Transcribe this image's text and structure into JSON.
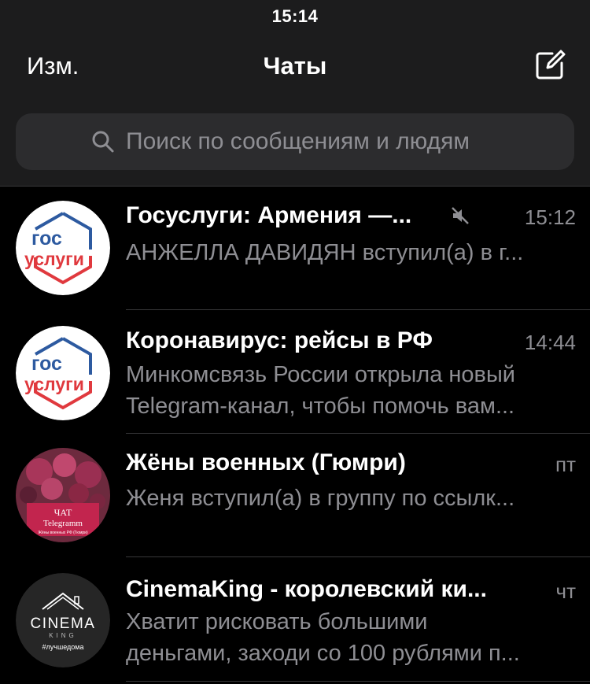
{
  "status_bar": {
    "time": "15:14"
  },
  "nav": {
    "edit_label": "Изм.",
    "title": "Чаты",
    "compose_icon": "compose-icon"
  },
  "search": {
    "placeholder": "Поиск по сообщениям и людям",
    "icon": "search-icon"
  },
  "colors": {
    "background": "#000000",
    "header": "#1c1c1d",
    "search_field": "#2c2c2e",
    "secondary_text": "#8e8e93",
    "gos_blue": "#2d5aa0",
    "gos_red": "#e0393e"
  },
  "chats": [
    {
      "title": "Госуслуги: Армения —...",
      "time": "15:12",
      "muted": true,
      "preview_lines": [
        "АНЖЕЛЛА ДАВИДЯН вступил(а) в г..."
      ],
      "avatar": {
        "type": "gosuslugi",
        "line1": "гос",
        "line2": "услуги"
      }
    },
    {
      "title": "Коронавирус: рейсы в РФ",
      "time": "14:44",
      "muted": false,
      "preview_lines": [
        "Минкомсвязь России открыла новый",
        "Telegram-канал, чтобы помочь вам..."
      ],
      "avatar": {
        "type": "gosuslugi",
        "line1": "гос",
        "line2": "услуги"
      }
    },
    {
      "title": "Жёны военных (Гюмри)",
      "time": "пт",
      "muted": false,
      "preview_lines": [
        "Женя вступил(а) в группу по ссылк..."
      ],
      "avatar": {
        "type": "roses",
        "line1": "ЧАТ",
        "line2": "Telegramm",
        "caption": "Жёны военных РФ (Гюмри)"
      }
    },
    {
      "title": "CinemaKing - королевский ки...",
      "time": "чт",
      "muted": false,
      "preview_lines": [
        "Хватит рисковать большими",
        "деньгами, заходи со 100 рублями п..."
      ],
      "avatar": {
        "type": "cinema",
        "line1": "CINEMA",
        "line2": "KING",
        "line3": "#лучшедома"
      }
    }
  ]
}
